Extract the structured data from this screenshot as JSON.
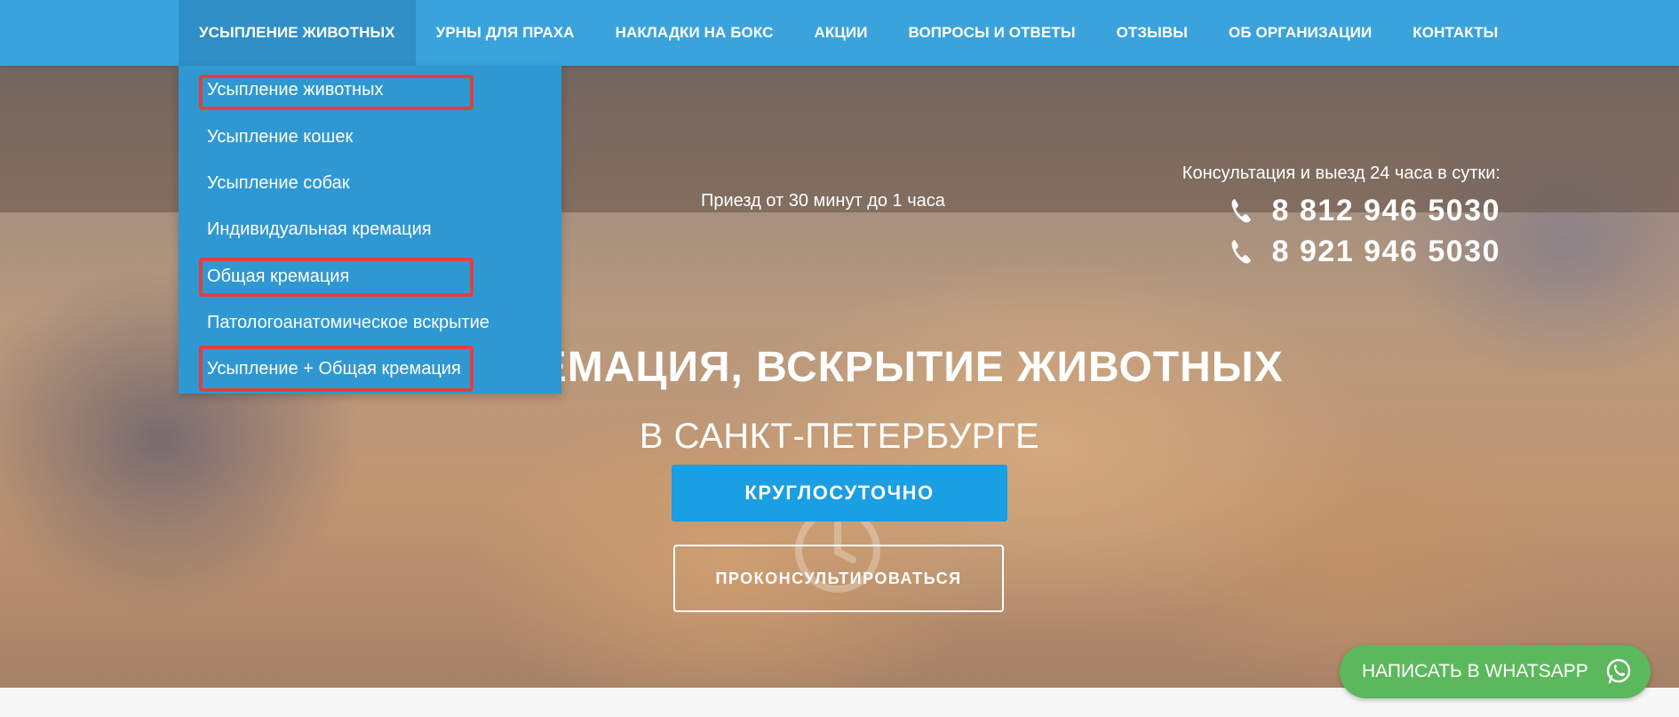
{
  "nav": {
    "items": [
      {
        "label": "УСЫПЛЕНИЕ ЖИВОТНЫХ",
        "active": true
      },
      {
        "label": "УРНЫ ДЛЯ ПРАХА"
      },
      {
        "label": "НАКЛАДКИ НА БОКС"
      },
      {
        "label": "АКЦИИ"
      },
      {
        "label": "ВОПРОСЫ И ОТВЕТЫ"
      },
      {
        "label": "ОТЗЫВЫ"
      },
      {
        "label": "ОБ ОРГАНИЗАЦИИ"
      },
      {
        "label": "КОНТАКТЫ"
      }
    ]
  },
  "dropdown": {
    "items": [
      {
        "label": "Усыпление животных",
        "highlighted": true
      },
      {
        "label": "Усыпление кошек"
      },
      {
        "label": "Усыпление собак"
      },
      {
        "label": "Индивидуальная кремация"
      },
      {
        "label": "Общая кремация",
        "highlighted": true
      },
      {
        "label": "Патологоанатомическое вскрытие"
      },
      {
        "label": "Усыпление + Общая кремация",
        "highlighted": true
      }
    ]
  },
  "header": {
    "arrival": "Приезд от 30 минут до 1 часа",
    "consult": "Консультация и выезд 24 часа в сутки:",
    "phones": [
      "8 812 946 5030",
      "8 921 946 5030"
    ]
  },
  "hero": {
    "title": "ИЕ, КРЕМАЦИЯ, ВСКРЫТИЕ ЖИВОТНЫХ",
    "subtitle": "В САНКТ-ПЕТЕРБУРГЕ",
    "primary_button": "КРУГЛОСУТОЧНО",
    "secondary_button": "ПРОКОНСУЛЬТИРОВАТЬСЯ"
  },
  "whatsapp": {
    "label": "НАПИСАТЬ В WHATSAPP",
    "icon": "whatsapp-icon"
  },
  "colors": {
    "nav_bg": "#3ba3dc",
    "nav_active": "#2f8fc7",
    "dropdown_bg": "#2f98d2",
    "highlight": "#e0413c",
    "primary_button": "#1a9ee4",
    "whatsapp": "#5cb85c"
  }
}
